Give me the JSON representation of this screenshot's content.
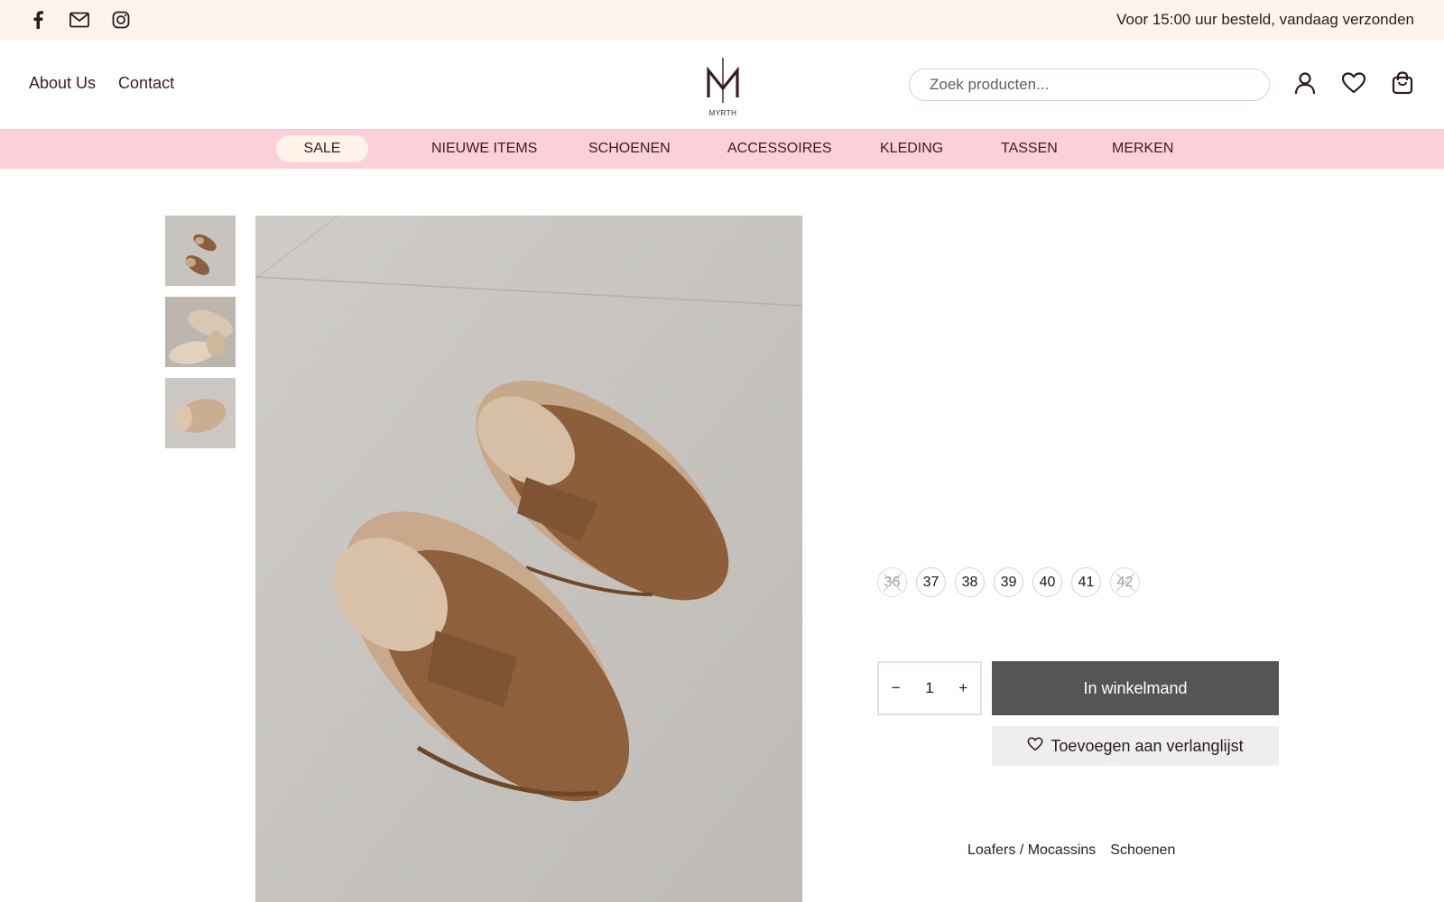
{
  "topbar": {
    "social_icons": [
      "facebook-icon",
      "mail-icon",
      "instagram-icon"
    ],
    "notice": "Voor 15:00 uur besteld, vandaag verzonden"
  },
  "header": {
    "links": [
      "About Us",
      "Contact"
    ],
    "logo_text": "MYRTH",
    "search_placeholder": "Zoek producten...",
    "icons": [
      "account-icon",
      "wishlist-heart-icon",
      "cart-bag-icon"
    ]
  },
  "categories": [
    "SALE",
    "NIEUWE ITEMS",
    "SCHOENEN",
    "ACCESSOIRES",
    "KLEDING",
    "TASSEN",
    "MERKEN"
  ],
  "product": {
    "sizes": [
      {
        "label": "36",
        "available": false
      },
      {
        "label": "37",
        "available": true
      },
      {
        "label": "38",
        "available": true
      },
      {
        "label": "39",
        "available": true
      },
      {
        "label": "40",
        "available": true
      },
      {
        "label": "41",
        "available": true
      },
      {
        "label": "42",
        "available": false
      }
    ],
    "quantity": "1",
    "qty_minus": "−",
    "qty_plus": "+",
    "add_to_cart": "In winkelmand",
    "add_to_wishlist": "Toevoegen aan verlanglijst",
    "category_links": [
      "Loafers / Mocassins",
      "Schoenen"
    ]
  },
  "colors": {
    "topbar_bg": "#fdf5ec",
    "catnav_bg": "#fbd0d8",
    "button_dark": "#555555",
    "brand_text": "#3a1a2a"
  }
}
